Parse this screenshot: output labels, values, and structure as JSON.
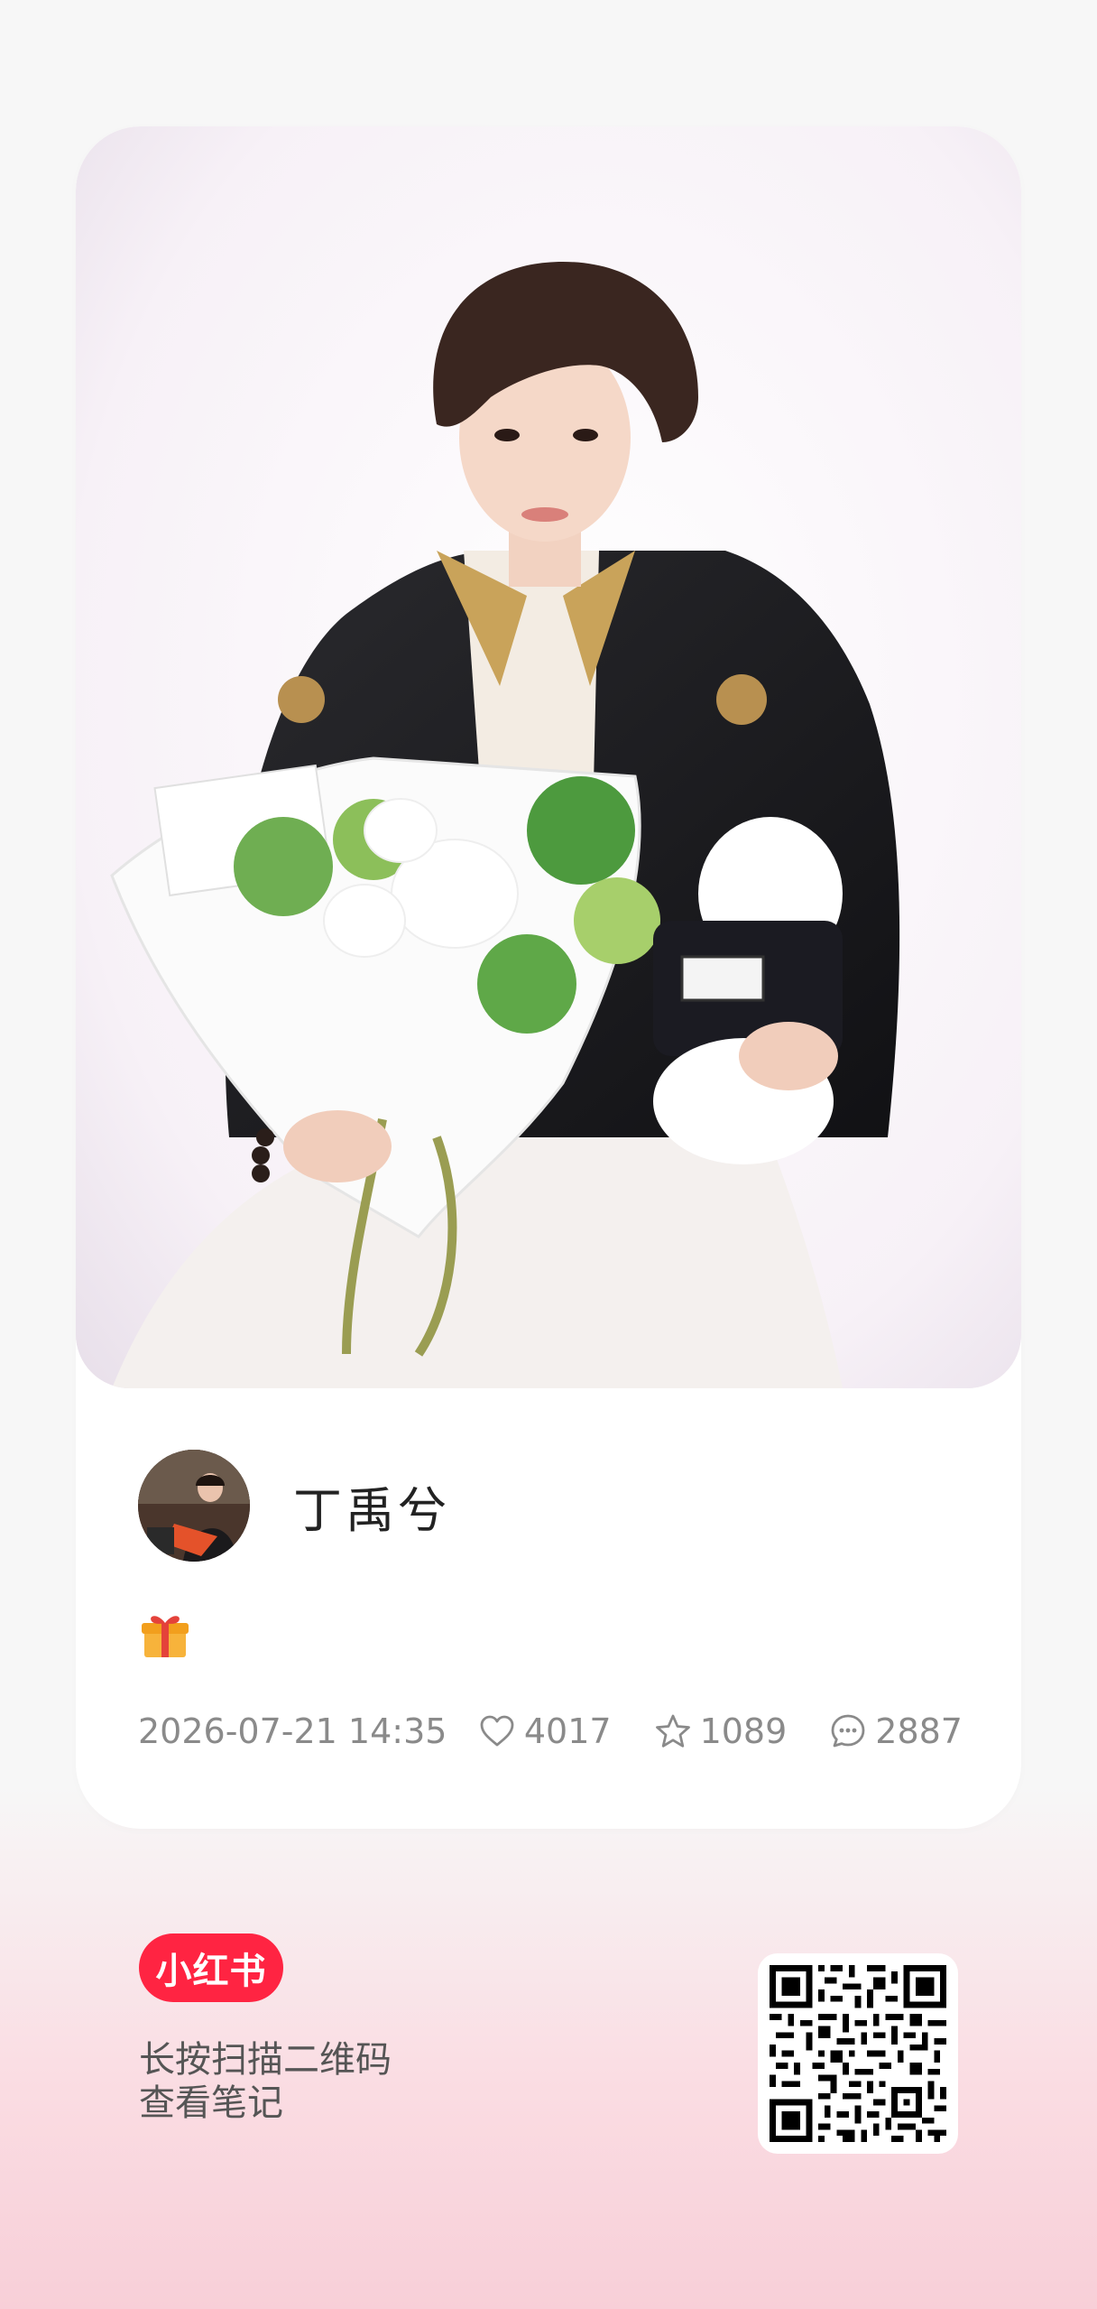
{
  "post": {
    "image_alt": "portrait photo",
    "author": {
      "name": "丁禹兮"
    },
    "content_emoji": "gift-icon",
    "date": "2026-07-21 14:35",
    "likes": "4017",
    "collects": "1089",
    "comments": "2887"
  },
  "footer": {
    "brand_label": "小红书",
    "hint_line1": "长按扫描二维码",
    "hint_line2": "查看笔记"
  },
  "colors": {
    "brand": "#ff2442",
    "meta_text": "#8a8a8a"
  }
}
